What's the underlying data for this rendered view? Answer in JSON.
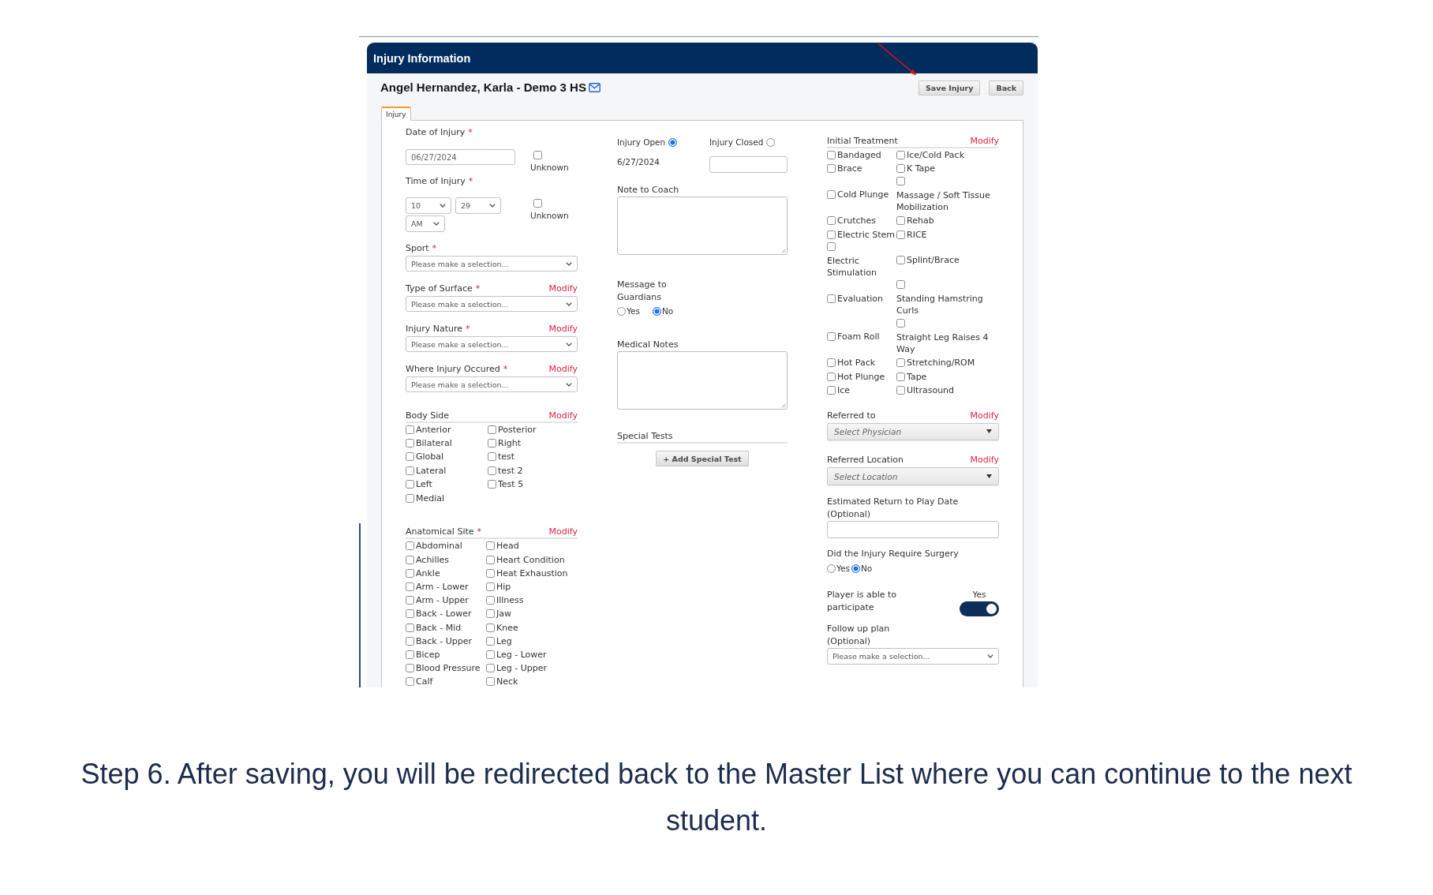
{
  "panel": {
    "title": "Injury Information"
  },
  "athlete": {
    "name": "Angel Hernandez, Karla - Demo 3 HS"
  },
  "actions": [
    "Save Injury",
    "Back"
  ],
  "tabs": [
    {
      "label": "Injury",
      "selected": true
    }
  ],
  "date_of_injury": {
    "label": "Date of Injury",
    "required_mark": "*",
    "value": "06/27/2024",
    "unknown": {
      "label": "Unknown",
      "checked": false
    }
  },
  "time_of_injury": {
    "label": "Time of Injury",
    "required_mark": "*",
    "selects": [
      "10",
      "29",
      "AM"
    ],
    "unknown": {
      "label": "Unknown",
      "checked": false
    }
  },
  "dropdowns": [
    {
      "label": "Sport",
      "required_mark": "*",
      "value": "Please make a selection..."
    },
    {
      "label": "Type of Surface",
      "required_mark": "*",
      "action": "Modify",
      "value": "Please make a selection..."
    },
    {
      "label": "Injury Nature",
      "required_mark": "*",
      "action": "Modify",
      "value": "Please make a selection..."
    },
    {
      "label": "Where Injury Occured",
      "required_mark": "*",
      "action": "Modify",
      "value": "Please make a selection..."
    }
  ],
  "body_side": {
    "label": "Body Side",
    "action": "Modify",
    "options": [
      {
        "label": "Anterior",
        "checked": false
      },
      {
        "label": "Bilateral",
        "checked": false
      },
      {
        "label": "Global",
        "checked": false
      },
      {
        "label": "Lateral",
        "checked": false
      },
      {
        "label": "Left",
        "checked": false
      },
      {
        "label": "Medial",
        "checked": false
      },
      {
        "label": "Posterior",
        "checked": false
      },
      {
        "label": "Right",
        "checked": false
      },
      {
        "label": "test",
        "checked": false
      },
      {
        "label": "test 2",
        "checked": false
      },
      {
        "label": "Test 5",
        "checked": false
      }
    ]
  },
  "anatomical_site": {
    "label": "Anatomical Site",
    "required_mark": "*",
    "action": "Modify",
    "options": [
      {
        "label": "Abdominal",
        "checked": false
      },
      {
        "label": "Achilles",
        "checked": false
      },
      {
        "label": "Ankle",
        "checked": false
      },
      {
        "label": "Arm - Lower",
        "checked": false
      },
      {
        "label": "Arm - Upper",
        "checked": false
      },
      {
        "label": "Back - Lower",
        "checked": false
      },
      {
        "label": "Back - Mid",
        "checked": false
      },
      {
        "label": "Back - Upper",
        "checked": false
      },
      {
        "label": "Bicep",
        "checked": false
      },
      {
        "label": "Blood Pressure",
        "checked": false
      },
      {
        "label": "Calf",
        "checked": false
      },
      {
        "label": "Head",
        "checked": false
      },
      {
        "label": "Heart Condition",
        "checked": false
      },
      {
        "label": "Heat Exhaustion",
        "checked": false
      },
      {
        "label": "Hip",
        "checked": false
      },
      {
        "label": "Illness",
        "checked": false
      },
      {
        "label": "Jaw",
        "checked": false
      },
      {
        "label": "Knee",
        "checked": false
      },
      {
        "label": "Leg",
        "checked": false
      },
      {
        "label": "Leg - Lower",
        "checked": false
      },
      {
        "label": "Leg - Upper",
        "checked": false
      },
      {
        "label": "Neck",
        "checked": false
      }
    ]
  },
  "status": [
    {
      "label": "Injury Open",
      "selected": true
    },
    {
      "label": "Injury Closed",
      "selected": false
    }
  ],
  "open_date": "6/27/2024",
  "note_to_coach": {
    "label": "Note to Coach"
  },
  "message_to_guardians": {
    "label": "Message to Guardians",
    "options": [
      {
        "label": "Yes",
        "selected": false
      },
      {
        "label": "No",
        "selected": true
      }
    ]
  },
  "medical_notes": {
    "label": "Medical Notes"
  },
  "special_tests": {
    "label": "Special Tests",
    "button": "+ Add Special Test"
  },
  "initial_treatment": {
    "label": "Initial Treatment",
    "action": "Modify",
    "options": [
      {
        "label": "Bandaged",
        "checked": false
      },
      {
        "label": "Brace",
        "checked": false
      },
      {
        "label": "Cold Plunge",
        "checked": false
      },
      {
        "label": "Crutches",
        "checked": false
      },
      {
        "label": "Electric Stem",
        "checked": false
      },
      {
        "label": "Electric Stimulation",
        "checked": false
      },
      {
        "label": "Evaluation",
        "checked": false
      },
      {
        "label": "Foam Roll",
        "checked": false
      },
      {
        "label": "Hot Pack",
        "checked": false
      },
      {
        "label": "Hot Plunge",
        "checked": false
      },
      {
        "label": "Ice",
        "checked": false
      },
      {
        "label": "Ice/Cold Pack",
        "checked": false
      },
      {
        "label": "K Tape",
        "checked": false
      },
      {
        "label": "Massage / Soft Tissue Mobilization",
        "checked": false
      },
      {
        "label": "Rehab",
        "checked": false
      },
      {
        "label": "RICE",
        "checked": false
      },
      {
        "label": "Splint/Brace",
        "checked": false
      },
      {
        "label": "Standing Hamstring Curls",
        "checked": false
      },
      {
        "label": "Straight Leg Raises 4 Way",
        "checked": false
      },
      {
        "label": "Stretching/ROM",
        "checked": false
      },
      {
        "label": "Tape",
        "checked": false
      },
      {
        "label": "Ultrasound",
        "checked": false
      }
    ]
  },
  "referrals": [
    {
      "label": "Referred to",
      "action": "Modify",
      "placeholder": "Select Physician"
    },
    {
      "label": "Referred Location",
      "action": "Modify",
      "placeholder": "Select Location"
    }
  ],
  "return_to_play": {
    "label": "Estimated Return to Play Date (Optional)"
  },
  "surgery": {
    "label": "Did the Injury Require Surgery",
    "options": [
      {
        "label": "Yes",
        "selected": false
      },
      {
        "label": "No",
        "selected": true
      }
    ]
  },
  "participation": {
    "label": "Player is able to participate",
    "state_label": "Yes",
    "on": true
  },
  "follow_up": {
    "label": "Follow up plan (Optional)",
    "value": "Please make a selection..."
  },
  "caption": "Step 6. After saving, you will be redirected back to the Master List where you can continue to the next student."
}
